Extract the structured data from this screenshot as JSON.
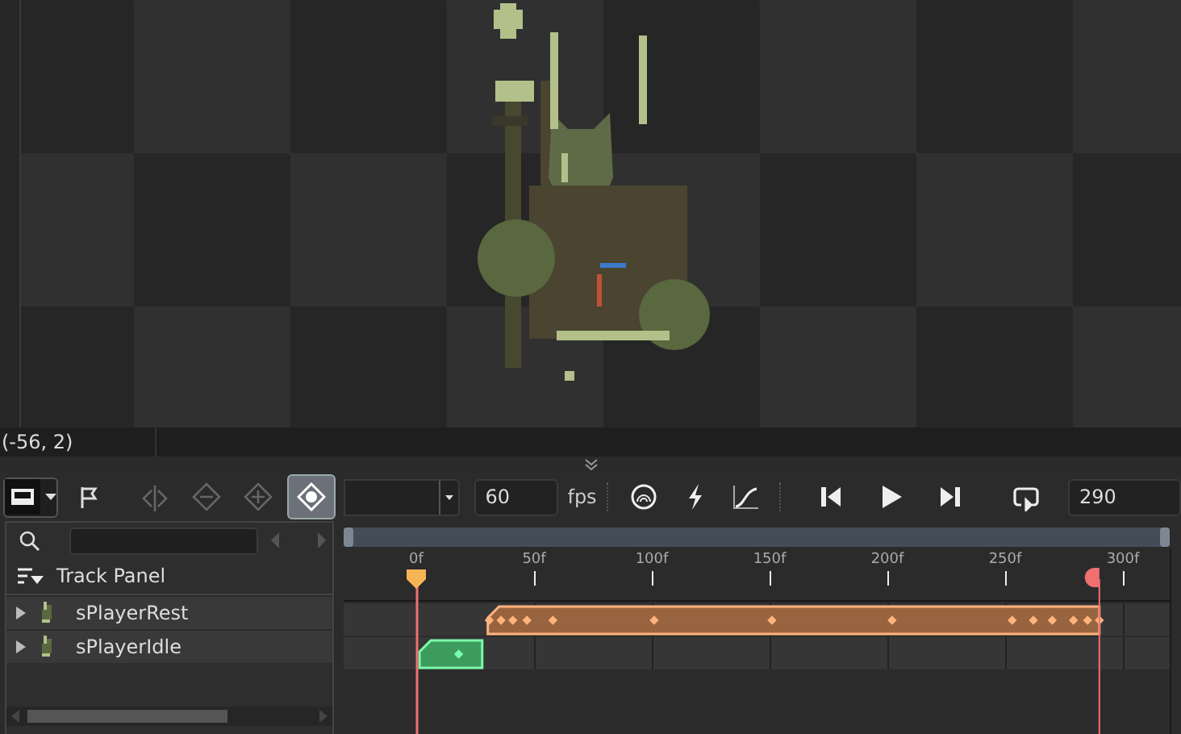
{
  "canvas": {
    "coordinates": "(-56, 2)"
  },
  "toolbar": {
    "tools": [
      {
        "kind": "flag",
        "selected": false,
        "disabled": false
      },
      {
        "kind": "split",
        "selected": false,
        "disabled": true
      },
      {
        "kind": "remove-key",
        "selected": false,
        "disabled": true
      },
      {
        "kind": "add-key",
        "selected": false,
        "disabled": true
      },
      {
        "kind": "key-mode",
        "selected": true,
        "disabled": false
      }
    ],
    "fps": "60",
    "fps_unit": "fps",
    "end_frame": "290"
  },
  "track_panel": {
    "title": "Track Panel",
    "tracks": [
      {
        "name": "sPlayerRest",
        "expanded": false
      },
      {
        "name": "sPlayerIdle",
        "expanded": false
      }
    ]
  },
  "timeline": {
    "ticks": [
      "0f",
      "50f",
      "100f",
      "150f",
      "200f",
      "250f",
      "300f"
    ],
    "clips": [
      {
        "color": "#98643f"
      },
      {
        "color": "#3d9b5e"
      }
    ]
  }
}
